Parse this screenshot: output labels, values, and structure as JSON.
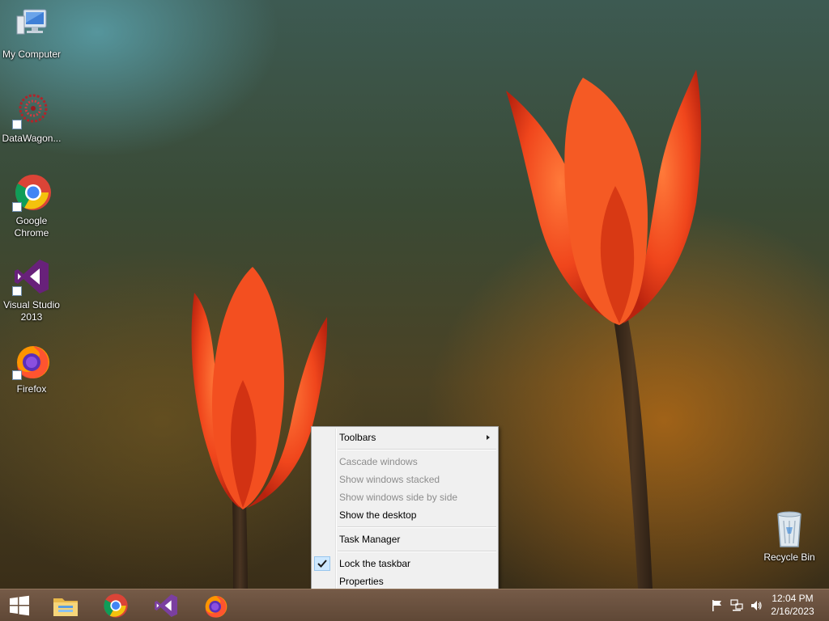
{
  "desktop": {
    "icons": [
      {
        "label": "My Computer",
        "icon": "computer-icon"
      },
      {
        "label": "DataWagon...",
        "icon": "datawagon-icon"
      },
      {
        "label": "Google Chrome",
        "icon": "chrome-icon"
      },
      {
        "label": "Visual Studio 2013",
        "icon": "visual-studio-icon"
      },
      {
        "label": "Firefox",
        "icon": "firefox-icon"
      },
      {
        "label": "Recycle Bin",
        "icon": "recycle-bin-icon"
      }
    ]
  },
  "context_menu": {
    "items": [
      {
        "label": "Toolbars",
        "enabled": true,
        "submenu": true
      },
      {
        "label": "Cascade windows",
        "enabled": false
      },
      {
        "label": "Show windows stacked",
        "enabled": false
      },
      {
        "label": "Show windows side by side",
        "enabled": false
      },
      {
        "label": "Show the desktop",
        "enabled": true
      },
      {
        "label": "Task Manager",
        "enabled": true
      },
      {
        "label": "Lock the taskbar",
        "enabled": true,
        "checked": true
      },
      {
        "label": "Properties",
        "enabled": true
      }
    ]
  },
  "taskbar": {
    "pinned": [
      {
        "icon": "start-icon"
      },
      {
        "icon": "file-explorer-icon"
      },
      {
        "icon": "chrome-icon"
      },
      {
        "icon": "visual-studio-icon"
      },
      {
        "icon": "firefox-icon"
      }
    ],
    "tray": {
      "icons": [
        "action-center-flag-icon",
        "network-icon",
        "volume-icon"
      ],
      "time": "12:04 PM",
      "date": "2/16/2023"
    }
  },
  "colors": {
    "menu_background": "#f0f0f0",
    "menu_disabled_text": "#8d8d8d",
    "check_highlight": "#cde8ff",
    "taskbar": "#6e5340"
  }
}
